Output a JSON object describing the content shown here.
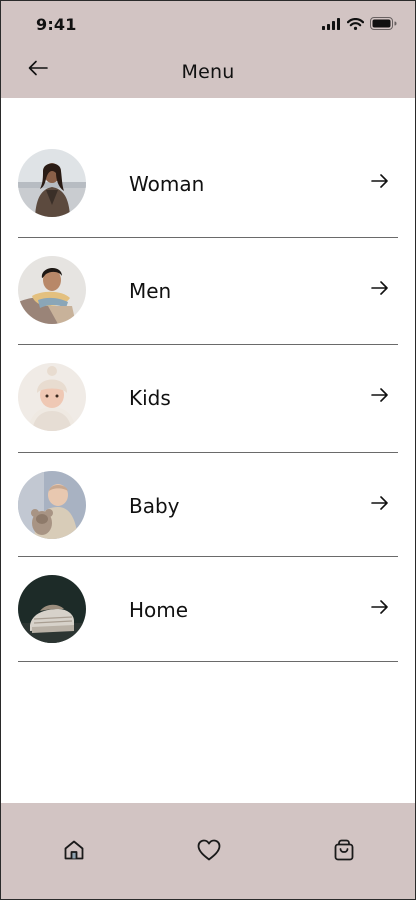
{
  "status_bar": {
    "time": "9:41",
    "icons": [
      "signal-icon",
      "wifi-icon",
      "battery-icon"
    ]
  },
  "header": {
    "title": "Menu",
    "back_icon": "arrow-left-icon"
  },
  "menu": {
    "items": [
      {
        "label": "Woman",
        "image": "woman-photo"
      },
      {
        "label": "Men",
        "image": "men-photo"
      },
      {
        "label": "Kids",
        "image": "kids-photo"
      },
      {
        "label": "Baby",
        "image": "baby-photo"
      },
      {
        "label": "Home",
        "image": "home-photo"
      }
    ],
    "arrow_icon": "arrow-right-icon"
  },
  "bottom_nav": {
    "items": [
      "home-icon",
      "heart-icon",
      "shopping-bag-icon"
    ]
  },
  "colors": {
    "bar_background": "#d2c4c3",
    "page_background": "#ffffff",
    "text": "#111111",
    "divider": "#6a6a6a"
  }
}
